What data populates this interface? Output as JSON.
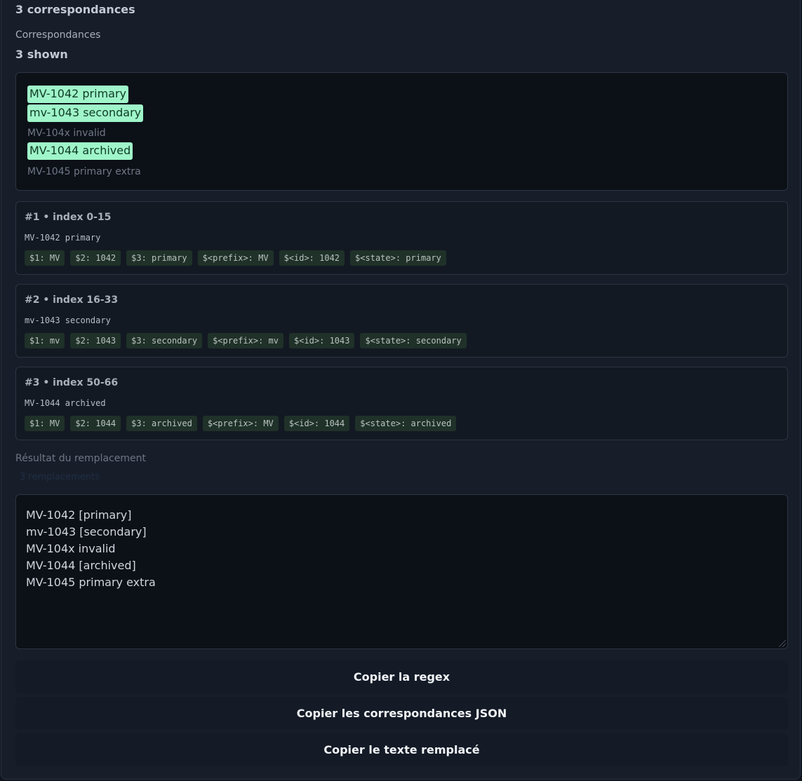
{
  "summary": "3 correspondances",
  "matches_section": {
    "label": "Correspondances",
    "shown": "3 shown"
  },
  "preview_lines": [
    {
      "text": "MV-1042 primary",
      "matched": true
    },
    {
      "text": "mv-1043 secondary",
      "matched": true
    },
    {
      "text": "MV-104x invalid",
      "matched": false
    },
    {
      "text": "MV-1044 archived",
      "matched": true
    },
    {
      "text": "MV-1045 primary extra",
      "matched": false
    }
  ],
  "matches": [
    {
      "header": "#1  •  index 0-15",
      "text": "MV-1042 primary",
      "groups": [
        "$1: MV",
        "$2: 1042",
        "$3: primary",
        "$<prefix>: MV",
        "$<id>: 1042",
        "$<state>: primary"
      ]
    },
    {
      "header": "#2  •  index 16-33",
      "text": "mv-1043 secondary",
      "groups": [
        "$1: mv",
        "$2: 1043",
        "$3: secondary",
        "$<prefix>: mv",
        "$<id>: 1043",
        "$<state>: secondary"
      ]
    },
    {
      "header": "#3  •  index 50-66",
      "text": "MV-1044 archived",
      "groups": [
        "$1: MV",
        "$2: 1044",
        "$3: archived",
        "$<prefix>: MV",
        "$<id>: 1044",
        "$<state>: archived"
      ]
    }
  ],
  "replacement": {
    "label": "Résultat du remplacement",
    "note": "3 remplacements",
    "lines": [
      "MV-1042 [primary]",
      "mv-1043 [secondary]",
      "MV-104x invalid",
      "MV-1044 [archived]",
      "MV-1045 primary extra"
    ]
  },
  "actions": {
    "copy_regex": "Copier la regex",
    "copy_json": "Copier les correspondances JSON",
    "copy_replaced": "Copier le texte remplacé"
  },
  "colors": {
    "highlight": "#9ff5c9",
    "chip_bg": "#1f3129",
    "panel_bg": "#171e2a"
  }
}
